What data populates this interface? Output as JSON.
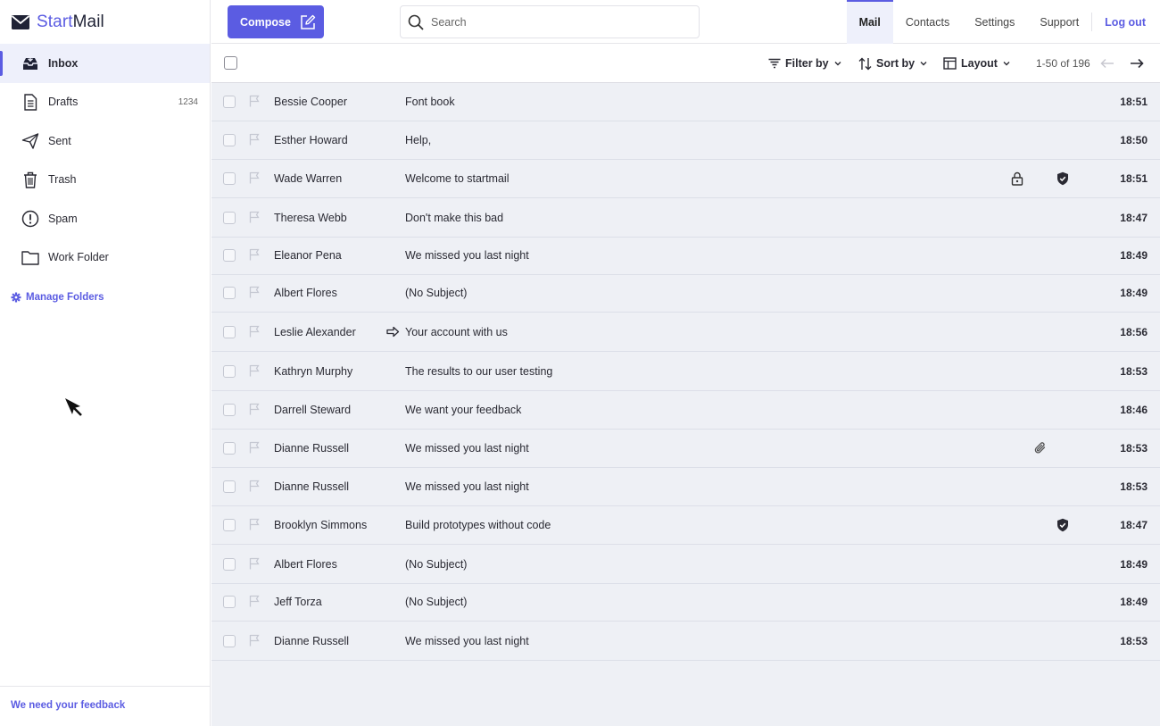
{
  "brand": {
    "start": "Start",
    "mail": "Mail"
  },
  "sidebar": {
    "items": [
      {
        "label": "Inbox",
        "icon": "inbox-icon",
        "count": ""
      },
      {
        "label": "Drafts",
        "icon": "document-icon",
        "count": "1234"
      },
      {
        "label": "Sent",
        "icon": "paper-plane-icon",
        "count": ""
      },
      {
        "label": "Trash",
        "icon": "trash-icon",
        "count": ""
      },
      {
        "label": "Spam",
        "icon": "alert-circle-icon",
        "count": ""
      },
      {
        "label": "Work Folder",
        "icon": "folder-icon",
        "count": ""
      }
    ],
    "manage_folders": "Manage Folders",
    "feedback": "We need your feedback"
  },
  "topbar": {
    "compose": "Compose",
    "search_placeholder": "Search",
    "tabs": [
      "Mail",
      "Contacts",
      "Settings",
      "Support"
    ],
    "logout": "Log out"
  },
  "toolbar": {
    "filter": "Filter by",
    "sort": "Sort by",
    "layout": "Layout",
    "pagination": "1-50 of 196"
  },
  "colors": {
    "accent": "#5b5ce2",
    "list_bg": "#eef0f5"
  },
  "emails": [
    {
      "sender": "Bessie Cooper",
      "subject": "Font book",
      "time": "18:51"
    },
    {
      "sender": "Esther Howard",
      "subject": "Help,",
      "time": "18:50"
    },
    {
      "sender": "Wade Warren",
      "subject": "Welcome to startmail",
      "time": "18:51",
      "lock": true,
      "shield": true
    },
    {
      "sender": "Theresa Webb",
      "subject": "Don't make this bad",
      "time": "18:47"
    },
    {
      "sender": "Eleanor Pena",
      "subject": "We missed you last night",
      "time": "18:49"
    },
    {
      "sender": "Albert Flores",
      "subject": "(No Subject)",
      "time": "18:49"
    },
    {
      "sender": "Leslie Alexander",
      "subject": "Your account with us",
      "time": "18:56",
      "forwarded": true
    },
    {
      "sender": "Kathryn Murphy",
      "subject": "The results to our user testing",
      "time": "18:53"
    },
    {
      "sender": "Darrell Steward",
      "subject": "We want your feedback",
      "time": "18:46"
    },
    {
      "sender": "Dianne Russell",
      "subject": "We missed you last night",
      "time": "18:53",
      "attachment": true
    },
    {
      "sender": "Dianne Russell",
      "subject": "We missed you last night",
      "time": "18:53"
    },
    {
      "sender": "Brooklyn Simmons",
      "subject": "Build prototypes without code",
      "time": "18:47",
      "shield": true
    },
    {
      "sender": "Albert Flores",
      "subject": "(No Subject)",
      "time": "18:49"
    },
    {
      "sender": "Jeff Torza",
      "subject": "(No Subject)",
      "time": "18:49"
    },
    {
      "sender": "Dianne Russell",
      "subject": "We missed you last night",
      "time": "18:53"
    }
  ]
}
